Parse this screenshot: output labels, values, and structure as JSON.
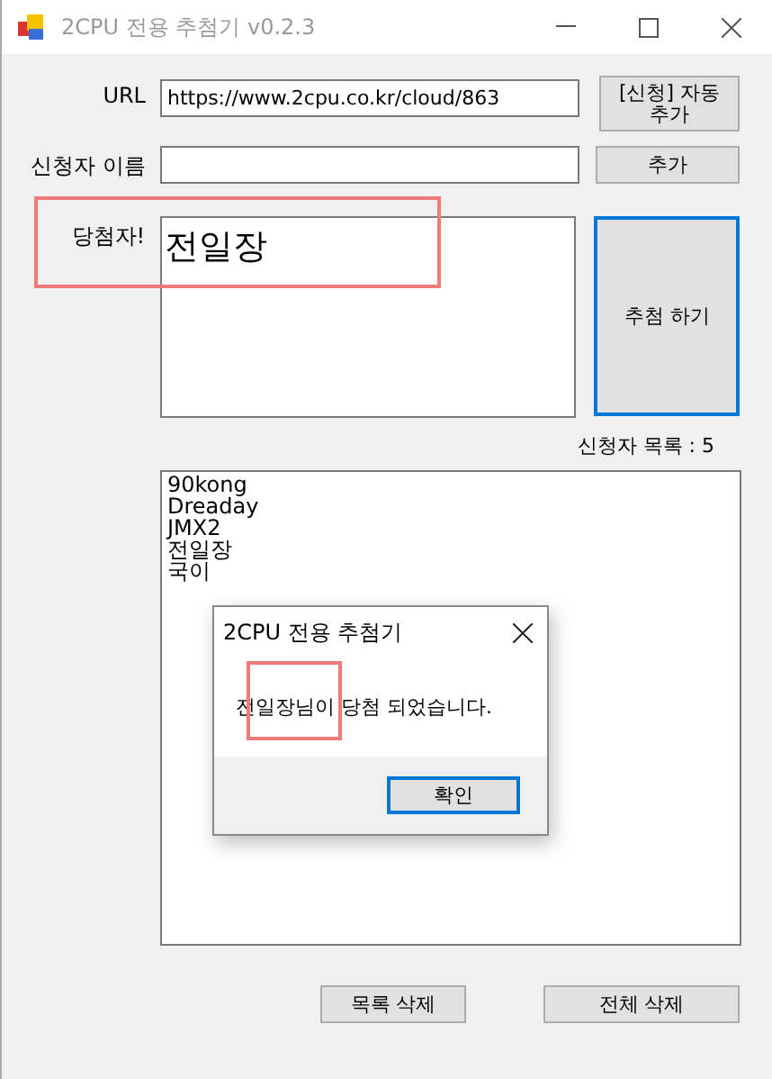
{
  "window": {
    "title": "2CPU 전용 추첨기 v0.2.3"
  },
  "url": {
    "label": "URL",
    "value": "https://www.2cpu.co.kr/cloud/863",
    "button": "[신청] 자동 추가"
  },
  "applicant": {
    "label": "신청자 이름",
    "button": "추가"
  },
  "winner": {
    "label": "당첨자!",
    "value": "전일장",
    "button": {
      "label": "추첨 하기",
      "focused": true
    }
  },
  "list": {
    "count_label": "신청자 목록 : 5",
    "items": [
      "90kong",
      "Dreaday",
      "JMX2",
      "전일장",
      "국이"
    ]
  },
  "buttons": [
    "목록 삭제",
    "전체 삭제"
  ],
  "dialog": {
    "title": "2CPU 전용 추첨기",
    "message": "전일장님이 당첨 되었습니다.",
    "ok_button": {
      "label": "확인",
      "focused": true
    }
  }
}
